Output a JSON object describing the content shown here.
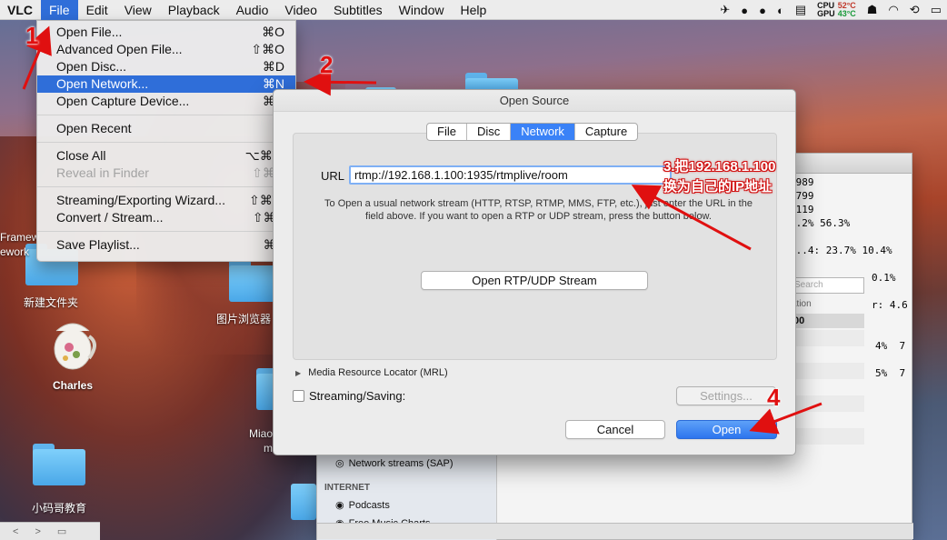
{
  "menubar": {
    "app": "VLC",
    "items": [
      "File",
      "Edit",
      "View",
      "Playback",
      "Audio",
      "Video",
      "Subtitles",
      "Window",
      "Help"
    ],
    "status": {
      "cpu_label": "CPU",
      "gpu_label": "GPU",
      "cpu_temp": "52°C",
      "gpu_temp": "43°C"
    }
  },
  "file_menu": {
    "items": [
      {
        "label": "Open File...",
        "shortcut": "⌘O"
      },
      {
        "label": "Advanced Open File...",
        "shortcut": "⇧⌘O"
      },
      {
        "label": "Open Disc...",
        "shortcut": "⌘D"
      },
      {
        "label": "Open Network...",
        "shortcut": "⌘N"
      },
      {
        "label": "Open Capture Device...",
        "shortcut": "⌘R"
      },
      {
        "label": "Open Recent",
        "shortcut": "▶"
      },
      {
        "label": "Close All",
        "shortcut": "⌥⌘W"
      },
      {
        "label": "Reveal in Finder",
        "shortcut": "⇧⌘R"
      },
      {
        "label": "Streaming/Exporting Wizard...",
        "shortcut": "⇧⌘W"
      },
      {
        "label": "Convert / Stream...",
        "shortcut": "⇧⌘S"
      },
      {
        "label": "Save Playlist...",
        "shortcut": "⌘S"
      }
    ]
  },
  "desktop": {
    "labels": [
      "Framew",
      "ework",
      "新建文件夹",
      "Charles",
      "图片浏览器",
      "Miao",
      "m",
      "小码哥教育"
    ]
  },
  "dialog": {
    "title": "Open Source",
    "tabs": [
      "File",
      "Disc",
      "Network",
      "Capture"
    ],
    "url_label": "URL",
    "url_value": "rtmp://192.168.1.100:1935/rtmplive/room",
    "help_text": "To Open a usual network stream (HTTP, RTSP, RTMP, MMS, FTP, etc.), just enter the URL in the field above. If you want to open a RTP or UDP stream, press the button below.",
    "rtp_button": "Open RTP/UDP Stream",
    "mrl_label": "Media Resource Locator (MRL)",
    "streaming_label": "Streaming/Saving:",
    "settings_button": "Settings...",
    "cancel_button": "Cancel",
    "open_button": "Open"
  },
  "background_window": {
    "stats_lines": [
      "7989",
      "2799",
      " 119",
      "6.2% 56.3%",
      "",
      "6..4: 23.7% 10.4%",
      "",
      "0.1%",
      "",
      "r: 4.6",
      "",
      "",
      "4%  7",
      "",
      "5%  7"
    ],
    "search_placeholder": "Search",
    "column": "ation",
    "column_value": "00",
    "sidebar_items": [
      "Network streams (SAP)",
      "Podcasts",
      "Free Music Charts"
    ],
    "sidebar_header": "INTERNET"
  },
  "annotations": {
    "step1": "1",
    "step2": "2",
    "step3_line1": "3.把192.168.1.100",
    "step3_line2": "换为自己的IP地址",
    "step4": "4"
  }
}
